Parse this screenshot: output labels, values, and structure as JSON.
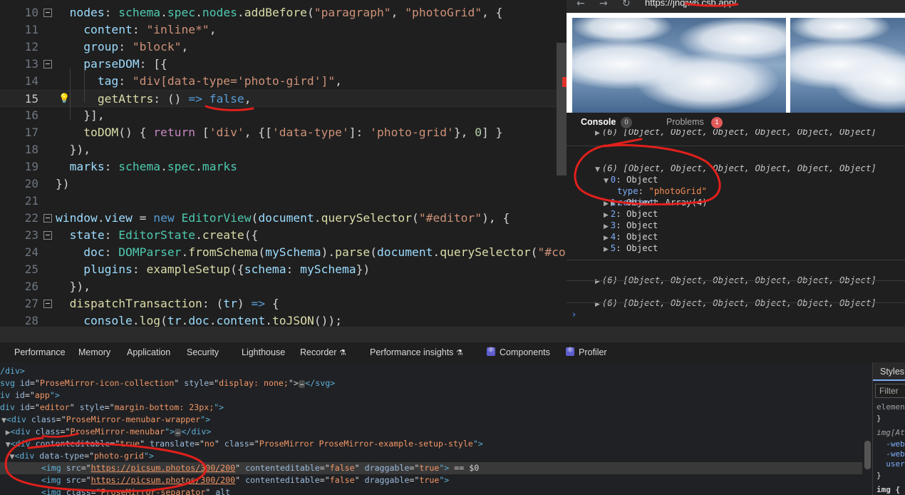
{
  "editor": {
    "lines": [
      {
        "num": "10",
        "fold": true,
        "tokens": [
          [
            "  ",
            "k"
          ],
          [
            "nodes",
            "p"
          ],
          [
            ": ",
            "k"
          ],
          [
            "schema",
            "c"
          ],
          [
            ".",
            "k"
          ],
          [
            "spec",
            "c"
          ],
          [
            ".",
            "k"
          ],
          [
            "nodes",
            "c"
          ],
          [
            ".",
            "k"
          ],
          [
            "addBefore",
            "f"
          ],
          [
            "(",
            "k"
          ],
          [
            "\"paragraph\"",
            "s"
          ],
          [
            ", ",
            "k"
          ],
          [
            "\"photoGrid\"",
            "s"
          ],
          [
            ", {",
            "k"
          ]
        ]
      },
      {
        "num": "11",
        "tokens": [
          [
            "    ",
            "k"
          ],
          [
            "content",
            "p"
          ],
          [
            ": ",
            "k"
          ],
          [
            "\"inline*\"",
            "s"
          ],
          [
            ",",
            "k"
          ]
        ]
      },
      {
        "num": "12",
        "tokens": [
          [
            "    ",
            "k"
          ],
          [
            "group",
            "p"
          ],
          [
            ": ",
            "k"
          ],
          [
            "\"block\"",
            "s"
          ],
          [
            ",",
            "k"
          ]
        ]
      },
      {
        "num": "13",
        "fold": true,
        "tokens": [
          [
            "    ",
            "k"
          ],
          [
            "parseDOM",
            "p"
          ],
          [
            ": [{",
            "k"
          ]
        ]
      },
      {
        "num": "14",
        "tokens": [
          [
            "      ",
            "k"
          ],
          [
            "tag",
            "p"
          ],
          [
            ": ",
            "k"
          ],
          [
            "\"div[data-type='photo-gird']\"",
            "s"
          ],
          [
            ",",
            "k"
          ]
        ]
      },
      {
        "num": "15",
        "current": true,
        "bulb": true,
        "tokens": [
          [
            "      ",
            "k"
          ],
          [
            "getAttrs",
            "f"
          ],
          [
            ": () ",
            "k"
          ],
          [
            "=>",
            "kw"
          ],
          [
            " ",
            "k"
          ],
          [
            "false",
            "fl"
          ],
          [
            ",",
            "k"
          ]
        ]
      },
      {
        "num": "16",
        "tokens": [
          [
            "    ",
            "k"
          ],
          [
            "}],",
            "k"
          ]
        ]
      },
      {
        "num": "17",
        "tokens": [
          [
            "    ",
            "k"
          ],
          [
            "toDOM",
            "f"
          ],
          [
            "() { ",
            "k"
          ],
          [
            "return",
            "ctl"
          ],
          [
            " [",
            "k"
          ],
          [
            "'div'",
            "s"
          ],
          [
            ", {[",
            "k"
          ],
          [
            "'data-type'",
            "s"
          ],
          [
            "]: ",
            "k"
          ],
          [
            "'photo-grid'",
            "s"
          ],
          [
            "}, ",
            "k"
          ],
          [
            "0",
            "n"
          ],
          [
            "] }",
            "k"
          ]
        ]
      },
      {
        "num": "18",
        "tokens": [
          [
            "  ",
            "k"
          ],
          [
            "}),",
            "k"
          ]
        ]
      },
      {
        "num": "19",
        "tokens": [
          [
            "  ",
            "k"
          ],
          [
            "marks",
            "p"
          ],
          [
            ": ",
            "k"
          ],
          [
            "schema",
            "c"
          ],
          [
            ".",
            "k"
          ],
          [
            "spec",
            "c"
          ],
          [
            ".",
            "k"
          ],
          [
            "marks",
            "c"
          ]
        ]
      },
      {
        "num": "20",
        "tokens": [
          [
            "})",
            "k"
          ]
        ]
      },
      {
        "num": "21",
        "tokens": []
      },
      {
        "num": "22",
        "fold": true,
        "tokens": [
          [
            "window",
            "p"
          ],
          [
            ".",
            "k"
          ],
          [
            "view",
            "p"
          ],
          [
            " = ",
            "k"
          ],
          [
            "new",
            "kw"
          ],
          [
            " ",
            "k"
          ],
          [
            "EditorView",
            "c"
          ],
          [
            "(",
            "k"
          ],
          [
            "document",
            "p"
          ],
          [
            ".",
            "k"
          ],
          [
            "querySelector",
            "f"
          ],
          [
            "(",
            "k"
          ],
          [
            "\"#editor\"",
            "s"
          ],
          [
            "), {",
            "k"
          ]
        ]
      },
      {
        "num": "23",
        "fold": true,
        "tokens": [
          [
            "  ",
            "k"
          ],
          [
            "state",
            "p"
          ],
          [
            ": ",
            "k"
          ],
          [
            "EditorState",
            "c"
          ],
          [
            ".",
            "k"
          ],
          [
            "create",
            "f"
          ],
          [
            "({",
            "k"
          ]
        ]
      },
      {
        "num": "24",
        "tokens": [
          [
            "    ",
            "k"
          ],
          [
            "doc",
            "p"
          ],
          [
            ": ",
            "k"
          ],
          [
            "DOMParser",
            "c"
          ],
          [
            ".",
            "k"
          ],
          [
            "fromSchema",
            "f"
          ],
          [
            "(",
            "k"
          ],
          [
            "mySchema",
            "p"
          ],
          [
            ").",
            "k"
          ],
          [
            "parse",
            "f"
          ],
          [
            "(",
            "k"
          ],
          [
            "document",
            "p"
          ],
          [
            ".",
            "k"
          ],
          [
            "querySelector",
            "f"
          ],
          [
            "(",
            "k"
          ],
          [
            "\"#cont",
            "s"
          ]
        ]
      },
      {
        "num": "25",
        "tokens": [
          [
            "    ",
            "k"
          ],
          [
            "plugins",
            "p"
          ],
          [
            ": ",
            "k"
          ],
          [
            "exampleSetup",
            "f"
          ],
          [
            "({",
            "k"
          ],
          [
            "schema",
            "p"
          ],
          [
            ": ",
            "k"
          ],
          [
            "mySchema",
            "p"
          ],
          [
            "})",
            "k"
          ]
        ]
      },
      {
        "num": "26",
        "tokens": [
          [
            "  ",
            "k"
          ],
          [
            "}),",
            "k"
          ]
        ]
      },
      {
        "num": "27",
        "fold": true,
        "tokens": [
          [
            "  ",
            "k"
          ],
          [
            "dispatchTransaction",
            "f"
          ],
          [
            ": (",
            "k"
          ],
          [
            "tr",
            "p"
          ],
          [
            ") ",
            "k"
          ],
          [
            "=>",
            "kw"
          ],
          [
            " {",
            "k"
          ]
        ]
      },
      {
        "num": "28",
        "tokens": [
          [
            "    ",
            "k"
          ],
          [
            "console",
            "p"
          ],
          [
            ".",
            "k"
          ],
          [
            "log",
            "f"
          ],
          [
            "(",
            "k"
          ],
          [
            "tr",
            "p"
          ],
          [
            ".",
            "k"
          ],
          [
            "doc",
            "p"
          ],
          [
            ".",
            "k"
          ],
          [
            "content",
            "p"
          ],
          [
            ".",
            "k"
          ],
          [
            "toJSON",
            "f"
          ],
          [
            "());",
            "k"
          ]
        ]
      }
    ]
  },
  "browser": {
    "url": "https://jnqjw6.csb.app/"
  },
  "console": {
    "tab_console": "Console",
    "console_count": "0",
    "tab_problems": "Problems",
    "problems_count": "1",
    "array_summary": "(6) [Object, Object, Object, Object, Object, Object]",
    "item0_key": "0",
    "item0_value": "Object",
    "type_key": "type",
    "type_value": "\"photoGrid\"",
    "content_key": "content",
    "content_value": "Array(4)",
    "items": [
      "1",
      "2",
      "3",
      "4",
      "5"
    ],
    "object_label": "Object",
    "prompt": "›"
  },
  "devtools": {
    "tabs": [
      "Performance",
      "Memory",
      "Application",
      "Security",
      "Lighthouse",
      "Recorder",
      "Performance insights",
      "Components",
      "Profiler"
    ]
  },
  "elements": {
    "lines": [
      [
        [
          "/div>",
          "tag"
        ]
      ],
      [
        [
          "svg ",
          "tag"
        ],
        [
          "id",
          "attr"
        ],
        [
          "=\"",
          "etxt"
        ],
        [
          "ProseMirror-icon-collection",
          "aval"
        ],
        [
          "\" ",
          "etxt"
        ],
        [
          "style",
          "attr"
        ],
        [
          "=\"",
          "etxt"
        ],
        [
          "display: none;",
          "aval"
        ],
        [
          "\">",
          "etxt"
        ],
        [
          "…",
          "ellip"
        ],
        [
          "</svg>",
          "tag"
        ]
      ],
      [
        [
          "iv ",
          "tag"
        ],
        [
          "id",
          "attr"
        ],
        [
          "=\"",
          "etxt"
        ],
        [
          "app",
          "aval"
        ],
        [
          "\">",
          "tag"
        ]
      ],
      [
        [
          "div ",
          "tag"
        ],
        [
          "id",
          "attr"
        ],
        [
          "=\"",
          "etxt"
        ],
        [
          "editor",
          "aval"
        ],
        [
          "\" ",
          "etxt"
        ],
        [
          "style",
          "attr"
        ],
        [
          "=\"",
          "etxt"
        ],
        [
          "margin-bottom: 23px;",
          "aval"
        ],
        [
          "\">",
          "tag"
        ]
      ],
      [
        [
          "▼",
          "etri"
        ],
        [
          "<div ",
          "tag"
        ],
        [
          "class",
          "attr"
        ],
        [
          "=\"",
          "etxt"
        ],
        [
          "ProseMirror-menubar-wrapper",
          "aval"
        ],
        [
          "\">",
          "tag"
        ]
      ],
      [
        [
          "  ▶",
          "etri"
        ],
        [
          "<div ",
          "tag"
        ],
        [
          "class",
          "attr"
        ],
        [
          "=\"",
          "etxt"
        ],
        [
          "ProseMirror-menubar",
          "aval"
        ],
        [
          "\">",
          "tag"
        ],
        [
          "…",
          "ellip"
        ],
        [
          "</div>",
          "tag"
        ]
      ],
      [
        [
          "  ▼",
          "etri"
        ],
        [
          "<div ",
          "tag"
        ],
        [
          "contenteditable",
          "attr"
        ],
        [
          "=\"",
          "etxt"
        ],
        [
          "true",
          "aval"
        ],
        [
          "\" ",
          "etxt"
        ],
        [
          "translate",
          "attr"
        ],
        [
          "=\"",
          "etxt"
        ],
        [
          "no",
          "aval"
        ],
        [
          "\" ",
          "etxt"
        ],
        [
          "class",
          "attr"
        ],
        [
          "=\"",
          "etxt"
        ],
        [
          "ProseMirror ProseMirror-example-setup-style",
          "aval"
        ],
        [
          "\">",
          "tag"
        ]
      ],
      [
        [
          "    ▼",
          "etri"
        ],
        [
          "<div ",
          "tag"
        ],
        [
          "data-type",
          "attr"
        ],
        [
          "=\"",
          "etxt"
        ],
        [
          "photo-grid",
          "aval"
        ],
        [
          "\">",
          "tag"
        ]
      ],
      [
        [
          "        <img ",
          "tag"
        ],
        [
          "src",
          "attr"
        ],
        [
          "=\"",
          "etxt"
        ],
        [
          "https://picsum.photos/300/200",
          "link"
        ],
        [
          "\" ",
          "etxt"
        ],
        [
          "contenteditable",
          "attr"
        ],
        [
          "=\"",
          "etxt"
        ],
        [
          "false",
          "aval"
        ],
        [
          "\" ",
          "etxt"
        ],
        [
          "draggable",
          "attr"
        ],
        [
          "=\"",
          "etxt"
        ],
        [
          "true",
          "aval"
        ],
        [
          "\">",
          "tag"
        ],
        [
          " == $0",
          "etxt"
        ]
      ],
      [
        [
          "        <img ",
          "tag"
        ],
        [
          "src",
          "attr"
        ],
        [
          "=\"",
          "etxt"
        ],
        [
          "https://picsum.photos/300/200",
          "link"
        ],
        [
          "\" ",
          "etxt"
        ],
        [
          "contenteditable",
          "attr"
        ],
        [
          "=\"",
          "etxt"
        ],
        [
          "false",
          "aval"
        ],
        [
          "\" ",
          "etxt"
        ],
        [
          "draggable",
          "attr"
        ],
        [
          "=\"",
          "etxt"
        ],
        [
          "true",
          "aval"
        ],
        [
          "\">",
          "tag"
        ]
      ],
      [
        [
          "        <img ",
          "tag"
        ],
        [
          "class",
          "attr"
        ],
        [
          "=\"",
          "etxt"
        ],
        [
          "ProseMirror-separator",
          "aval"
        ],
        [
          "\" ",
          "etxt"
        ],
        [
          "alt",
          "attr"
        ]
      ]
    ]
  },
  "styles_panel": {
    "tab": "Styles",
    "filter": "Filter",
    "lines": [
      "element",
      "}",
      "img[Att",
      "  -web",
      "  -web",
      "  user",
      "}",
      "img {"
    ]
  },
  "colors": {
    "annotation": "#e0201c",
    "console_badge": "#e05a5a"
  }
}
